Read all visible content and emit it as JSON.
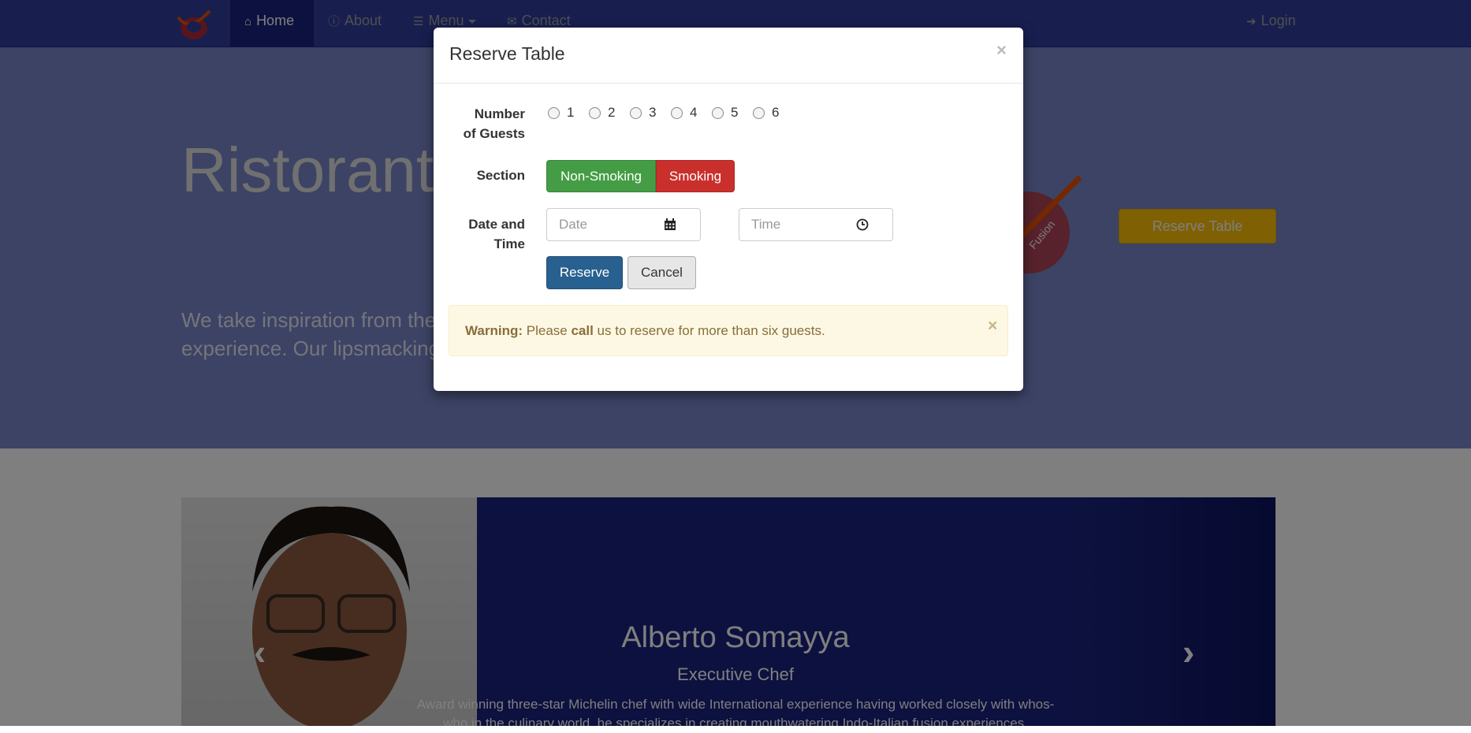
{
  "navbar": {
    "items": [
      {
        "label": "Home",
        "icon": "home-icon"
      },
      {
        "label": "About",
        "icon": "info-icon"
      },
      {
        "label": "Menu",
        "icon": "list-icon"
      },
      {
        "label": "Contact",
        "icon": "envelope-icon"
      }
    ],
    "login": {
      "label": "Login",
      "icon": "sign-in-icon"
    }
  },
  "jumbotron": {
    "title": "Ristorante",
    "text_line1": "We take inspiration from the",
    "text_line2": "experience. Our lipsmacking",
    "reserve_label": "Reserve Table",
    "logo_text": "Fusion"
  },
  "chef": {
    "name": "Alberto Somayya",
    "role": "Executive Chef",
    "description_line1": "Award winning three-star Michelin chef with wide International experience having worked closely with whos-",
    "description_line2": "who in the culinary world, he specializes in creating mouthwatering Indo-Italian fusion experiences."
  },
  "modal": {
    "title": "Reserve Table",
    "close_symbol": "×",
    "guests_label_line1": "Number",
    "guests_label_line2": "of Guests",
    "guest_options": [
      "1",
      "2",
      "3",
      "4",
      "5",
      "6"
    ],
    "section_label": "Section",
    "section_options": [
      "Non-Smoking",
      "Smoking"
    ],
    "datetime_label_line1": "Date and",
    "datetime_label_line2": "Time",
    "date_placeholder": "Date",
    "time_placeholder": "Time",
    "reserve_label": "Reserve",
    "cancel_label": "Cancel",
    "alert": {
      "strong": "Warning:",
      "text_before": " Please ",
      "bold_word": "call",
      "text_after": " us to reserve for more than six guests."
    }
  },
  "colors": {
    "navbar": "#303f9f",
    "jumbotron": "#7986cb",
    "reserve_yellow": "#ffc107",
    "nonsmoking_green": "#449d44",
    "smoking_red": "#c9302c",
    "primary_blue": "#286090"
  }
}
